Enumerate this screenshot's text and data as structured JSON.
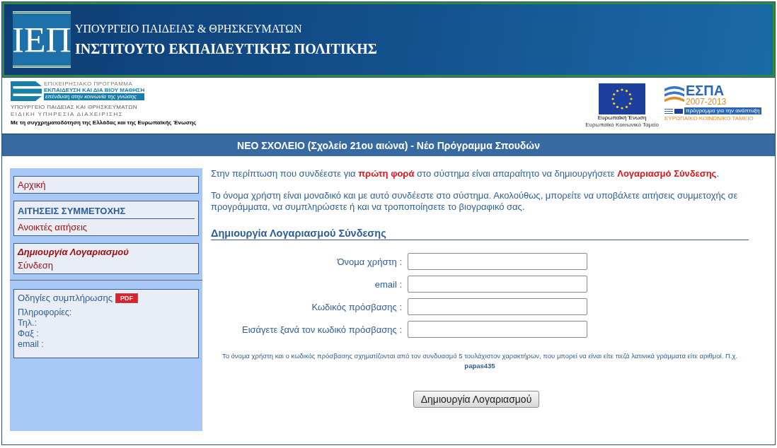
{
  "header": {
    "logo_mark": "ΙΕΠ",
    "ministry": "ΥΠΟΥΡΓΕΙΟ ΠΑΙΔΕΙΑΣ & ΘΡΗΣΚΕΥΜΑΤΩΝ",
    "institute": "ΙΝΣΤΙΤΟΥΤΟ ΕΚΠΑΙΔΕΥΤΙΚΗΣ ΠΟΛΙΤΙΚΗΣ"
  },
  "sponsors": {
    "program": {
      "lines": [
        "ΕΠΙΧΕΙΡΗΣΙΑΚΟ ΠΡΟΓΡΑΜΜΑ",
        "ΕΚΠΑΙΔΕΥΣΗ ΚΑΙ ΔΙΑ ΒΙΟΥ ΜΑΘΗΣΗ"
      ],
      "motto": "επένδυση στην κοινωνία της γνώσης",
      "ministry": "ΥΠΟΥΡΓΕΙΟ ΠΑΙΔΕΙΑΣ ΚΑΙ ΘΡΗΣΚΕΥΜΑΤΩΝ",
      "service": "ΕΙΔΙΚΗ ΥΠΗΡΕΣΙΑ ΔΙΑΧΕΙΡΙΣΗΣ",
      "cofunding": "Με τη συγχρηματοδότηση της Ελλάδας και της Ευρωπαϊκής Ένωσης"
    },
    "eu": {
      "name": "Ευρωπαϊκή Ένωση",
      "fund": "Ευρωπαϊκό Κοινωνικό Ταμείο"
    },
    "espa": {
      "name": "ΕΣΠΑ",
      "years": "2007-2013",
      "tagline": "πρόγραμμα για την ανάπτυξη",
      "fund": "ΕΥΡΩΠΑΪΚΟ ΚΟΙΝΩΝΙΚΟ ΤΑΜΕΙΟ"
    }
  },
  "title_bar": "ΝΕΟ ΣΧΟΛΕΙΟ (Σχολείο 21ου αιώνα) - Νέο Πρόγραμμα Σπουδών",
  "sidebar": {
    "groups": [
      {
        "items": [
          {
            "label": "Αρχική",
            "selected": false
          }
        ]
      },
      {
        "heading": "ΑΙΤΗΣΕΙΣ ΣΥΜΜΕΤΟΧΗΣ",
        "items": [
          {
            "label": "Ανοικτές αιτήσεις",
            "selected": false
          }
        ]
      },
      {
        "items": [
          {
            "label": "Δημιουργία Λογαριασμού",
            "selected": true
          },
          {
            "label": "Σύνδεση",
            "selected": false
          }
        ]
      }
    ],
    "info": {
      "guide": "Οδηγίες συμπλήρωσης",
      "badge": "PDF",
      "lines": [
        "Πληροφορίες:",
        "Τηλ.:",
        "Φαξ :",
        "email :"
      ]
    }
  },
  "intro": [
    "Στην περίπτωση που συνδέεστε για **πρώτη φορά** στο σύστημα είναι απαραίτητο να δημιουργήσετε **Λογαριασμό Σύνδεσης**.",
    "Το όνομα χρήστη είναι μοναδικό και με αυτό συνδέεστε στο σύστημα. Ακολούθως, μπορείτε να υποβάλετε αιτήσεις συμμετοχής σε προγράμματα, να συμπληρώσετε ή και να τροποποίησετε το βιογραφικό σας."
  ],
  "form": {
    "heading": "Δημιουργία Λογαριασμού Σύνδεσης",
    "fields": [
      {
        "label": "Όνομα χρήστη :"
      },
      {
        "label": "email :"
      },
      {
        "label": "Κωδικός πρόσβασης :"
      },
      {
        "label": "Εισάγετε ξανά τον κωδικό πρόσβασης :"
      }
    ],
    "hint": "Το όνομα χρήστη και ο κωδικός πρόσβασης σχηματίζονται από τον συνδυασμό 5 τουλάχιστον χαρακτήρων, που μπορεί να είναι είτε πεζά λατινικά γράμματα είτε αριθμοί. Π.χ. **papas435**",
    "submit": "Δημιουργία Λογαριασμού"
  }
}
